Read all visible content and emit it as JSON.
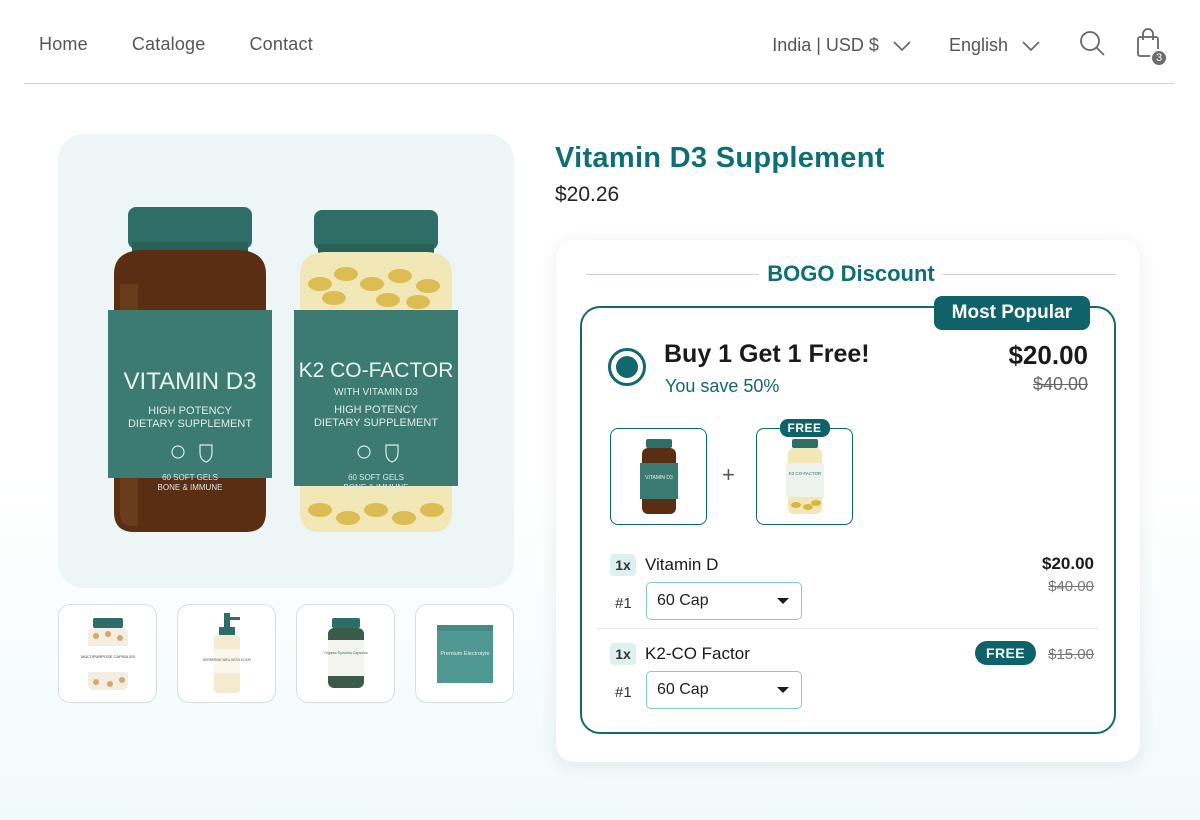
{
  "nav": {
    "links": [
      "Home",
      "Cataloge",
      "Contact"
    ],
    "currency": "India | USD $",
    "language": "English",
    "cart_count": "3"
  },
  "gallery": {
    "main": {
      "jar1": {
        "title": "VITAMIN D3",
        "line1": "HIGH POTENCY",
        "line2": "DIETARY SUPPLEMENT",
        "foot1": "60 SOFT GELS",
        "foot2": "BONE & IMMUNE"
      },
      "jar2": {
        "title": "K2 CO-FACTOR",
        "sub": "WITH VITAMIN D3",
        "line1": "HIGH POTENCY",
        "line2": "DIETARY SUPPLEMENT",
        "foot1": "60 SOFT GELS",
        "foot2": "BONE & IMMUNE"
      }
    },
    "thumbs": [
      {
        "label": "MULTIPURPOSE CAPSULES"
      },
      {
        "label": "BERBERINE WELLNESS ELIXIR"
      },
      {
        "label": "Organic Spirulina Capsules"
      },
      {
        "label": "Premium Electrolyte"
      }
    ]
  },
  "product": {
    "title": "Vitamin D3 Supplement",
    "price": "$20.26"
  },
  "bogo": {
    "heading": "BOGO Discount",
    "badge": "Most Popular",
    "offer_title": "Buy 1 Get 1 Free!",
    "offer_save": "You save 50%",
    "offer_price": "$20.00",
    "offer_compare": "$40.00",
    "free_tag": "FREE",
    "plus": "+",
    "items": [
      {
        "qty": "1x",
        "name": "Vitamin D",
        "num": "#1",
        "variant": "60 Cap",
        "price": "$20.00",
        "compare": "$40.00"
      },
      {
        "qty": "1x",
        "name": "K2-CO Factor",
        "num": "#1",
        "variant": "60 Cap",
        "free_label": "FREE",
        "compare": "$15.00"
      }
    ]
  },
  "colors": {
    "accent": "#0f6e73",
    "badge": "#0f6269",
    "card_bg": "#edf5f6"
  }
}
